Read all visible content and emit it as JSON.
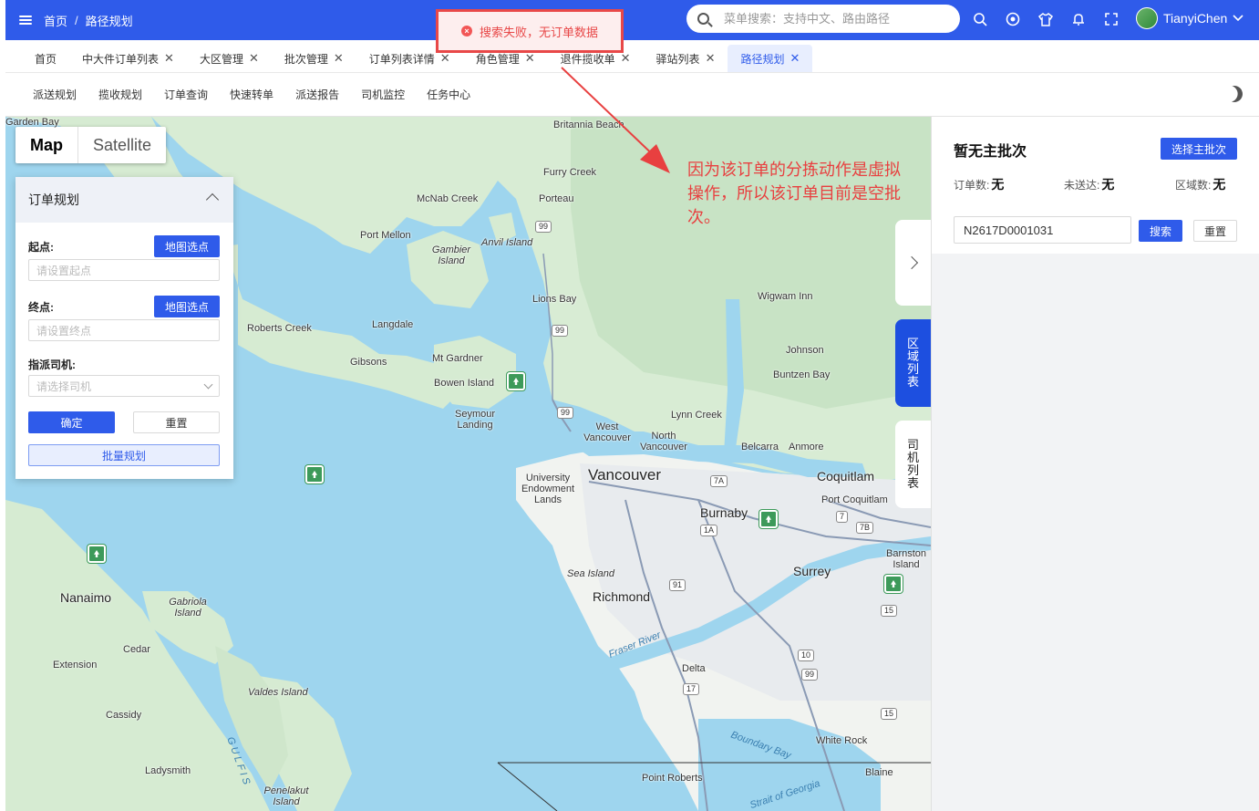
{
  "header": {
    "breadcrumb": [
      "首页",
      "路径规划"
    ],
    "breadcrumb_sep": "/",
    "search_placeholder": "菜单搜索：支持中文、路由路径",
    "user": "TianyiChen",
    "icons": [
      "search-icon",
      "github-icon",
      "shirt-icon",
      "bell-icon",
      "fullscreen-icon"
    ]
  },
  "tabs": [
    {
      "label": "首页",
      "closable": false
    },
    {
      "label": "中大件订单列表",
      "closable": true
    },
    {
      "label": "大区管理",
      "closable": true
    },
    {
      "label": "批次管理",
      "closable": true
    },
    {
      "label": "订单列表详情",
      "closable": true
    },
    {
      "label": "角色管理",
      "closable": true
    },
    {
      "label": "退件揽收单",
      "closable": true
    },
    {
      "label": "驿站列表",
      "closable": true
    },
    {
      "label": "路径规划",
      "closable": true,
      "active": true
    }
  ],
  "subnav": [
    "派送规划",
    "揽收规划",
    "订单查询",
    "快速转单",
    "派送报告",
    "司机监控",
    "任务中心"
  ],
  "map": {
    "map_type": [
      "Map",
      "Satellite"
    ],
    "labels": {
      "vancouver": "Vancouver",
      "burnaby": "Burnaby",
      "coquitlam": "Coquitlam",
      "port_coquitlam": "Port Coquitlam",
      "surrey": "Surrey",
      "richmond": "Richmond",
      "delta": "Delta",
      "white_rock": "White Rock",
      "point_roberts": "Point Roberts",
      "blaine": "Blaine",
      "nanaimo": "Nanaimo",
      "gabriola": "Gabriola Island",
      "cedar": "Cedar",
      "extension": "Extension",
      "cassidy": "Cassidy",
      "ladysmith": "Ladysmith",
      "penelakut": "Penelakut Island",
      "valdes": "Valdes Island",
      "gibsons": "Gibsons",
      "langdale": "Langdale",
      "roberts_creek": "Roberts Creek",
      "mt_gardner": "Mt Gardner",
      "bowen": "Bowen Island",
      "seymour": "Seymour Landing",
      "west_van": "West Vancouver",
      "north_van": "North Vancouver",
      "lynn_creek": "Lynn Creek",
      "belcarra": "Belcarra",
      "anmore": "Anmore",
      "ubc": "University Endowment Lands",
      "sea_island": "Sea Island",
      "barnston": "Barnston Island",
      "lions_bay": "Lions Bay",
      "port_mellon": "Port Mellon",
      "gambier": "Gambier Island",
      "anvil": "Anvil Island",
      "mcnab": "McNab Creek",
      "porteau": "Porteau",
      "furry": "Furry Creek",
      "britannia": "Britannia Beach",
      "wigwam": "Wigwam Inn",
      "johnson": "Johnson",
      "buntzen": "Buntzen Bay",
      "garden_bay": "Garden Bay",
      "fraser": "Fraser River",
      "boundary": "Boundary Bay",
      "strait": "Strait of Georgia",
      "gulf": "G U L F  I S"
    },
    "routes": [
      "99",
      "99",
      "99",
      "7A",
      "1A",
      "7",
      "7B",
      "91",
      "10",
      "99",
      "17",
      "15",
      "15"
    ]
  },
  "order_panel": {
    "title": "订单规划",
    "start_label": "起点:",
    "start_placeholder": "请设置起点",
    "end_label": "终点:",
    "end_placeholder": "请设置终点",
    "map_pick": "地图选点",
    "driver_label": "指派司机:",
    "driver_placeholder": "请选择司机",
    "confirm": "确定",
    "reset": "重置",
    "batch": "批量规划"
  },
  "side_tabs": {
    "region_list": [
      "区",
      "域",
      "列",
      "表"
    ],
    "driver_list": [
      "司",
      "机",
      "列",
      "表"
    ]
  },
  "right_panel": {
    "title": "暂无主批次",
    "choose_batch": "选择主批次",
    "order_count_label": "订单数:",
    "order_count": "无",
    "undelivered_label": "未送达:",
    "undelivered": "无",
    "region_count_label": "区域数:",
    "region_count": "无",
    "order_id": "N2617D0001031",
    "search": "搜索",
    "reset": "重置"
  },
  "toast": {
    "message": "搜索失败，无订单数据",
    "type": "error"
  },
  "annotation": "因为该订单的分拣动作是虚拟操作，所以该订单目前是空批次。",
  "colors": {
    "primary": "#2f5bea",
    "error": "#e84848",
    "annotation": "#e84040"
  }
}
